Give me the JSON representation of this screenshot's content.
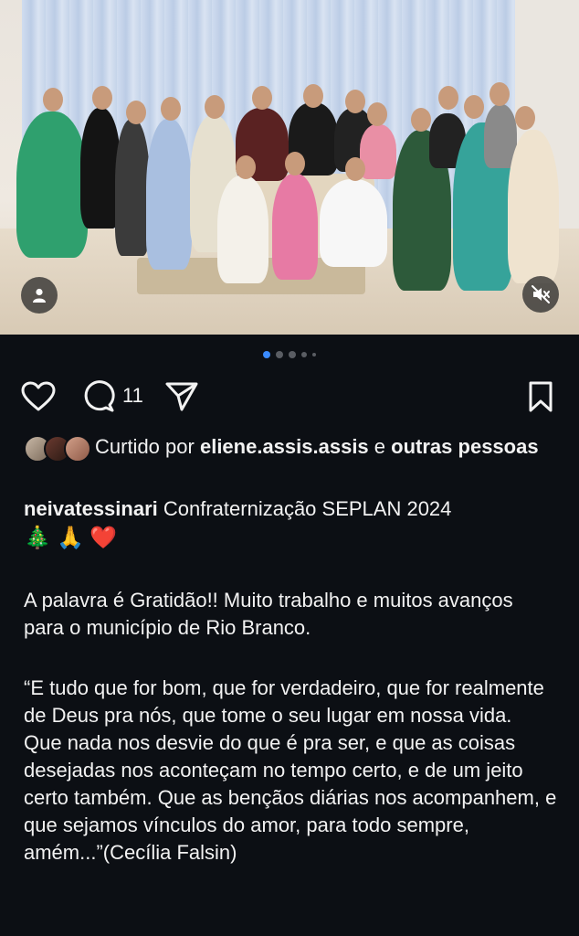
{
  "post": {
    "photo_alt": "",
    "carousel": {
      "count": 5,
      "active_index": 0
    },
    "comment_count": "11",
    "likes": {
      "prefix": "Curtido por",
      "first_user": "eliene.assis.assis",
      "joiner": "e",
      "others": "outras pessoas"
    },
    "caption": {
      "username": "neivatessinari",
      "title": "Confraternização SEPLAN 2024",
      "emojis": [
        "🎄",
        "🙏",
        "❤️"
      ],
      "paragraph1": "A palavra é Gratidão!! Muito trabalho e muitos avanços para o município de Rio Branco.",
      "paragraph2a": "“E tudo que for bom, que for verdadeiro, que for realmente de Deus pra nós, que tome o seu lugar em nossa vida.",
      "paragraph2b": "Que nada nos desvie do que é pra ser, e que as coisas desejadas nos aconteçam no tempo certo, e de um jeito certo também. Que as bençãos diárias nos acompanhem, e que sejamos vínculos do amor, para todo sempre, amém...”(Cecília Falsin)"
    }
  },
  "icons": {
    "like": "heart-icon",
    "comment": "comment-icon",
    "share": "paper-plane-icon",
    "save": "bookmark-icon",
    "tags": "user-icon",
    "audio": "muted-speaker-icon"
  },
  "colors": {
    "background": "#0c0f14",
    "text": "#f2f2f2",
    "active_dot": "#3a8bff"
  }
}
